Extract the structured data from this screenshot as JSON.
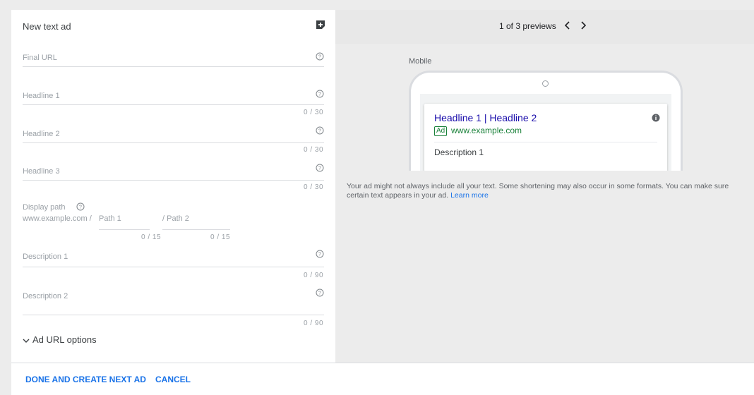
{
  "form": {
    "title": "New text ad",
    "final_url": {
      "label": "Final URL"
    },
    "headline1": {
      "label": "Headline 1",
      "counter": "0 / 30"
    },
    "headline2": {
      "label": "Headline 2",
      "counter": "0 / 30"
    },
    "headline3": {
      "label": "Headline 3",
      "counter": "0 / 30"
    },
    "display_path": {
      "label": "Display path",
      "domain": "www.example.com /",
      "path1": {
        "placeholder": "Path 1",
        "counter": "0 / 15"
      },
      "path2": {
        "placeholder": "/ Path 2",
        "counter": "0 / 15"
      }
    },
    "description1": {
      "label": "Description 1",
      "counter": "0 / 90"
    },
    "description2": {
      "label": "Description 2",
      "counter": "0 / 90"
    },
    "ad_url_options": "Ad URL options"
  },
  "preview": {
    "count": "1 of 3 previews",
    "mobile_label": "Mobile",
    "ad": {
      "headline": "Headline 1 | Headline 2",
      "badge": "Ad",
      "url": "www.example.com",
      "description": "Description 1"
    },
    "disclaimer": "Your ad might not always include all your text. Some shortening may also occur in some formats. You can make sure certain text appears in your ad.",
    "learn_more": "Learn more"
  },
  "footer": {
    "done_label": "DONE AND CREATE NEXT AD",
    "cancel_label": "CANCEL"
  },
  "colors": {
    "accent": "#1a73e8",
    "headline_link": "#1a0dab",
    "url_green": "#188038"
  },
  "icons": [
    "add-note-icon",
    "help-icon",
    "chevron-left-icon",
    "chevron-right-icon",
    "info-icon",
    "chevron-down-icon"
  ]
}
